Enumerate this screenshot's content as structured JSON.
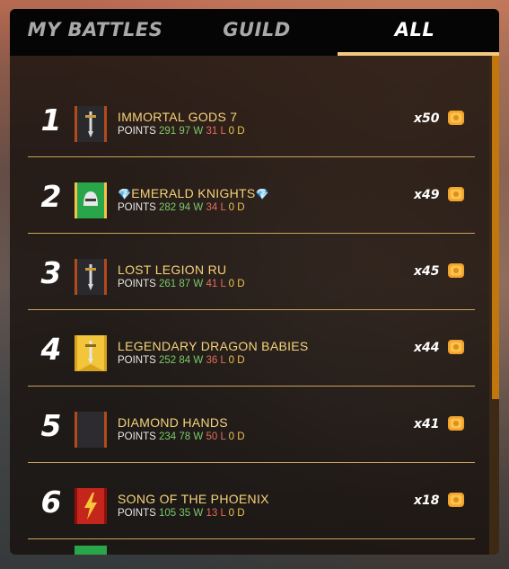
{
  "tabs": {
    "my_battles": "MY BATTLES",
    "guild": "GUILD",
    "all": "ALL",
    "active": "ALL"
  },
  "rows": [
    {
      "rank": "1",
      "name": "IMMORTAL GODS 7",
      "gem_prefix": "",
      "gem_suffix": "",
      "points_label": "POINTS",
      "points": "291",
      "wins": "97 W",
      "losses": "31 L",
      "draws": "0 D",
      "reward": "x50",
      "banner": "dark-sword",
      "reward_icon": "scroll-icon"
    },
    {
      "rank": "2",
      "name": "EMERALD KNIGHTS",
      "gem_prefix": "💎",
      "gem_suffix": "💎",
      "points_label": "POINTS",
      "points": "282",
      "wins": "94 W",
      "losses": "34 L",
      "draws": "0 D",
      "reward": "x49",
      "banner": "green-knight",
      "reward_icon": "scroll-icon"
    },
    {
      "rank": "3",
      "name": "LOST LEGION RU",
      "gem_prefix": "",
      "gem_suffix": "",
      "points_label": "POINTS",
      "points": "261",
      "wins": "87 W",
      "losses": "41 L",
      "draws": "0 D",
      "reward": "x45",
      "banner": "dark-sword",
      "reward_icon": "scroll-icon"
    },
    {
      "rank": "4",
      "name": "LEGENDARY DRAGON BABIES",
      "gem_prefix": "",
      "gem_suffix": "",
      "points_label": "POINTS",
      "points": "252",
      "wins": "84 W",
      "losses": "36 L",
      "draws": "0 D",
      "reward": "x44",
      "banner": "gold-sword",
      "reward_icon": "scroll-icon"
    },
    {
      "rank": "5",
      "name": "DIAMOND HANDS",
      "gem_prefix": "",
      "gem_suffix": "",
      "points_label": "POINTS",
      "points": "234",
      "wins": "78 W",
      "losses": "50 L",
      "draws": "0 D",
      "reward": "x41",
      "banner": "dark-plain",
      "reward_icon": "scroll-icon"
    },
    {
      "rank": "6",
      "name": "SONG OF THE PHOENIX",
      "gem_prefix": "",
      "gem_suffix": "",
      "points_label": "POINTS",
      "points": "105",
      "wins": "35 W",
      "losses": "13 L",
      "draws": "0 D",
      "reward": "x18",
      "banner": "red-lightning",
      "reward_icon": "scroll-icon"
    }
  ],
  "colors": {
    "accent": "#f2c97e",
    "name": "#f6d27a",
    "wins": "#7bc96a",
    "losses": "#e26b5a",
    "draws": "#f2c34d",
    "scroll": "#c2770e"
  }
}
